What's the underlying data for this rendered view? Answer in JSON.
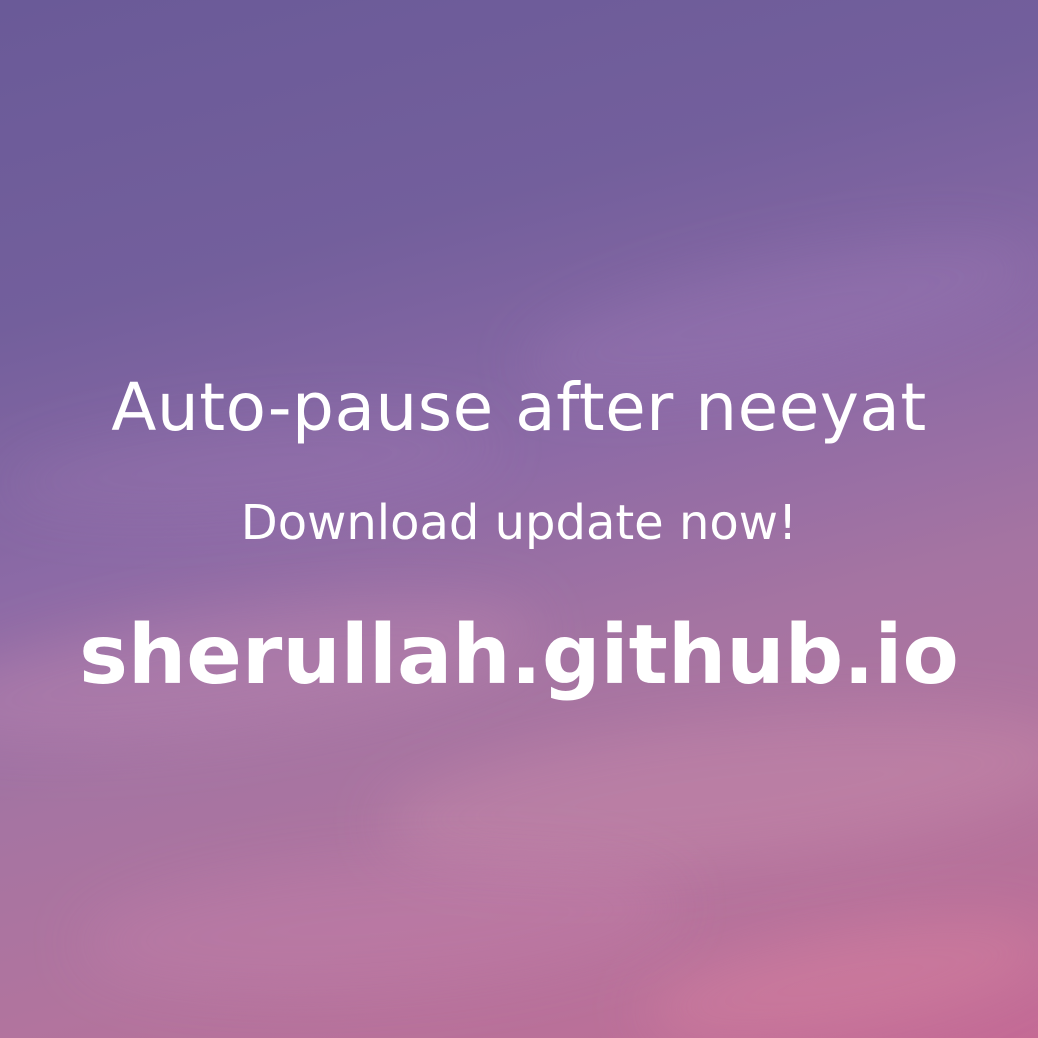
{
  "headline": "Auto-pause after neeyat",
  "subline": "Download update now!",
  "url": "sherullah.github.io",
  "colors": {
    "text": "#ffffff",
    "sky_top": "#6a5a98",
    "sky_bottom": "#c46a95"
  }
}
